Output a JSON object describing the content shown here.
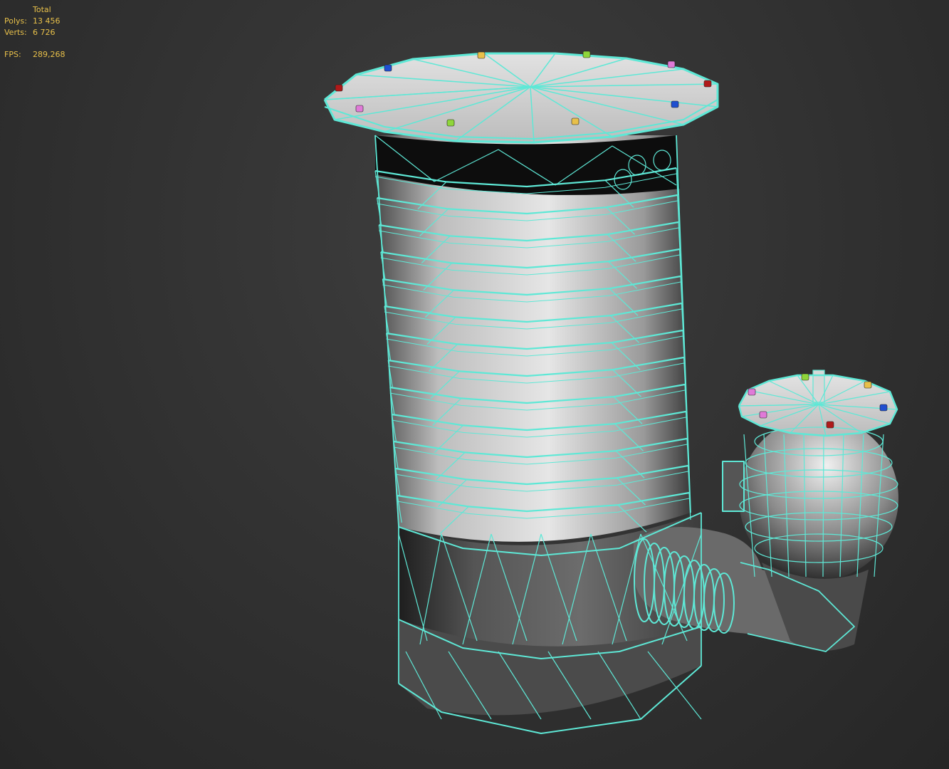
{
  "stats": {
    "header": "Total",
    "polys_label": "Polys:",
    "polys_value": "13 456",
    "verts_label": "Verts:",
    "verts_value": "6 726",
    "fps_label": "FPS:",
    "fps_value": "289,268"
  },
  "colors": {
    "wire": "#5ee8d6",
    "background": "#333333",
    "stats_text": "#e8c04a",
    "shade_light": "#e6e6e6",
    "shade_mid": "#9a9a9a",
    "shade_dark": "#4a4a4a"
  }
}
